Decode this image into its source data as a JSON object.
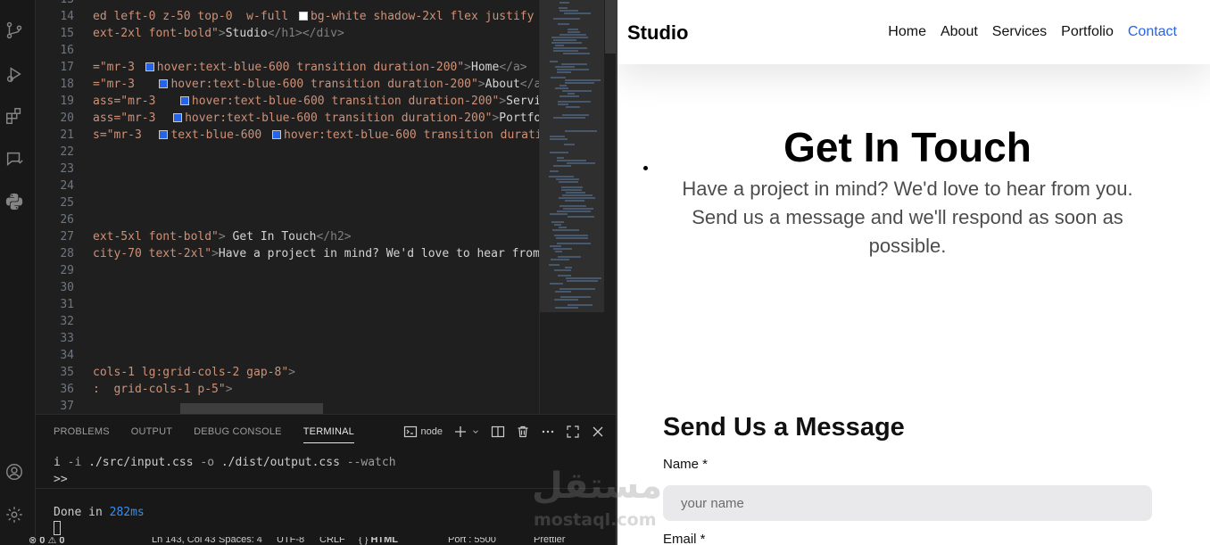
{
  "editor": {
    "lines": [
      {
        "num": "13",
        "parts": []
      },
      {
        "num": "14",
        "parts": [
          {
            "t": "str",
            "v": "ed left-0 z-50 top-0  w-full "
          },
          {
            "t": "swatch",
            "c": "white"
          },
          {
            "t": "str",
            "v": "bg-white shadow-2xl flex justify"
          }
        ]
      },
      {
        "num": "15",
        "parts": [
          {
            "t": "str",
            "v": "ext-2xl font-bold\""
          },
          {
            "t": "tag",
            "v": ">"
          },
          {
            "t": "txt",
            "v": "Studio"
          },
          {
            "t": "tag",
            "v": "</h1></div>"
          }
        ]
      },
      {
        "num": "16",
        "parts": []
      },
      {
        "num": "17",
        "parts": [
          {
            "t": "str",
            "v": "=\"mr-3 "
          },
          {
            "t": "swatch",
            "c": "blue"
          },
          {
            "t": "str",
            "v": "hover:text-blue-600 transition duration-200\""
          },
          {
            "t": "tag",
            "v": ">"
          },
          {
            "t": "txt",
            "v": "Home"
          },
          {
            "t": "tag",
            "v": "</a>"
          }
        ]
      },
      {
        "num": "18",
        "parts": [
          {
            "t": "str",
            "v": "=\"mr-3   "
          },
          {
            "t": "swatch",
            "c": "blue"
          },
          {
            "t": "str",
            "v": "hover:text-blue-600 transition duration-200\""
          },
          {
            "t": "tag",
            "v": ">"
          },
          {
            "t": "txt",
            "v": "About"
          },
          {
            "t": "tag",
            "v": "</a>"
          }
        ]
      },
      {
        "num": "19",
        "parts": [
          {
            "t": "str",
            "v": "ass=\"mr-3   "
          },
          {
            "t": "swatch",
            "c": "blue"
          },
          {
            "t": "str",
            "v": "hover:text-blue-600 transition duration-200\""
          },
          {
            "t": "tag",
            "v": ">"
          },
          {
            "t": "txt",
            "v": "Servic"
          }
        ]
      },
      {
        "num": "20",
        "parts": [
          {
            "t": "str",
            "v": "ass=\"mr-3  "
          },
          {
            "t": "swatch",
            "c": "blue"
          },
          {
            "t": "str",
            "v": "hover:text-blue-600 transition duration-200\""
          },
          {
            "t": "tag",
            "v": ">"
          },
          {
            "t": "txt",
            "v": "Portfo"
          }
        ]
      },
      {
        "num": "21",
        "parts": [
          {
            "t": "str",
            "v": "s=\"mr-3  "
          },
          {
            "t": "swatch",
            "c": "blue"
          },
          {
            "t": "str",
            "v": "text-blue-600 "
          },
          {
            "t": "swatch",
            "c": "blue"
          },
          {
            "t": "str",
            "v": "hover:text-blue-600 transition durati"
          }
        ]
      },
      {
        "num": "22",
        "parts": []
      },
      {
        "num": "23",
        "parts": []
      },
      {
        "num": "24",
        "parts": []
      },
      {
        "num": "25",
        "parts": []
      },
      {
        "num": "26",
        "parts": []
      },
      {
        "num": "27",
        "parts": [
          {
            "t": "str",
            "v": "ext-5xl font-bold\""
          },
          {
            "t": "tag",
            "v": ">"
          },
          {
            "t": "txt",
            "v": " Get In Touch"
          },
          {
            "t": "tag",
            "v": "</h2>"
          }
        ]
      },
      {
        "num": "28",
        "parts": [
          {
            "t": "str",
            "v": "city-70 text-2xl\""
          },
          {
            "t": "tag",
            "v": ">"
          },
          {
            "t": "txt",
            "v": "Have a project in mind? We'd love to hear from"
          }
        ]
      },
      {
        "num": "29",
        "parts": []
      },
      {
        "num": "30",
        "parts": []
      },
      {
        "num": "31",
        "parts": []
      },
      {
        "num": "32",
        "parts": []
      },
      {
        "num": "33",
        "parts": []
      },
      {
        "num": "34",
        "parts": []
      },
      {
        "num": "35",
        "parts": [
          {
            "t": "str",
            "v": "cols-1 lg:grid-cols-2 gap-8\""
          },
          {
            "t": "tag",
            "v": ">"
          }
        ]
      },
      {
        "num": "36",
        "parts": [
          {
            "t": "str",
            "v": ":  grid-cols-1 p-5\""
          },
          {
            "t": "tag",
            "v": ">"
          }
        ]
      },
      {
        "num": "37",
        "parts": []
      }
    ]
  },
  "activity_bar": {
    "icons": [
      "source-control-icon",
      "run-debug-icon",
      "extensions-icon",
      "remote-explorer-icon",
      "python-icon",
      "account-icon",
      "settings-gear-icon"
    ]
  },
  "panel": {
    "tabs": [
      {
        "label": "PROBLEMS",
        "active": false
      },
      {
        "label": "OUTPUT",
        "active": false
      },
      {
        "label": "DEBUG CONSOLE",
        "active": false
      },
      {
        "label": "TERMINAL",
        "active": true
      }
    ],
    "terminal_name": "node",
    "terminal": {
      "cmd_prefix": "i ",
      "flag_i": "-i",
      "input_path": " ./src/input.css ",
      "flag_o": "-o",
      "output_path": " ./dist/output.css ",
      "flag_watch": "--watch",
      "prompt": ">>",
      "done_text": "Done in ",
      "done_time": "282ms"
    }
  },
  "status_bar": {
    "errors": "0",
    "warnings": "0",
    "position": "Ln 143, Col 43",
    "spaces": "Spaces: 4",
    "encoding": "UTF-8",
    "eol": "CRLF",
    "language": "HTML",
    "port": "Port : 5500",
    "prettier": "Prettier"
  },
  "preview": {
    "brand": "Studio",
    "nav": [
      {
        "label": "Home",
        "active": false
      },
      {
        "label": "About",
        "active": false
      },
      {
        "label": "Services",
        "active": false
      },
      {
        "label": "Portfolio",
        "active": false
      },
      {
        "label": "Contact",
        "active": true
      }
    ],
    "hero_title": "Get In Touch",
    "hero_subtitle": "Have a project in mind? We'd love to hear from you. Send us a message and we'll respond as soon as possible.",
    "form_title": "Send Us a Message",
    "name_label": "Name *",
    "name_placeholder": "your name",
    "email_label": "Email *"
  },
  "watermark": {
    "arabic": "مستقل",
    "latin": "mostaql.com"
  },
  "colors": {
    "accent": "#2563eb",
    "string": "#ce9178",
    "tag": "#808080",
    "editor_bg": "#1f1f1f"
  }
}
